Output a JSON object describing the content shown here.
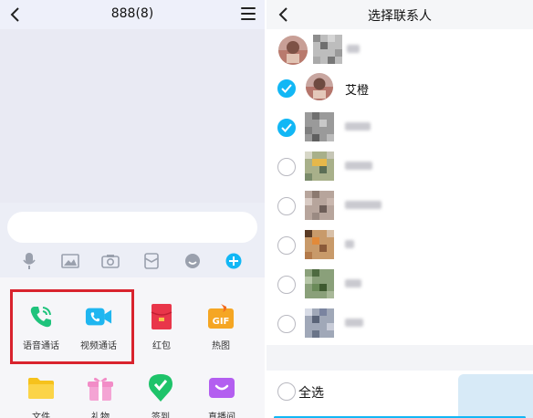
{
  "chat": {
    "title": "888(8)",
    "panel_apps": [
      {
        "label": "语音通话",
        "icon": "voice-call-icon",
        "color": "#1fc37c"
      },
      {
        "label": "视频通话",
        "icon": "video-call-icon",
        "color": "#1fb6f0"
      },
      {
        "label": "红包",
        "icon": "red-packet-icon",
        "color": "#e9364a"
      },
      {
        "label": "热图",
        "icon": "gif-icon",
        "color": "#f5a623"
      },
      {
        "label": "文件",
        "icon": "folder-icon",
        "color": "#f6c21c"
      },
      {
        "label": "礼物",
        "icon": "gift-icon",
        "color": "#f28cc7"
      },
      {
        "label": "签到",
        "icon": "checkin-icon",
        "color": "#1ec36a"
      },
      {
        "label": "直播间",
        "icon": "live-room-icon",
        "color": "#b35ef0"
      }
    ]
  },
  "select_contacts": {
    "title": "选择联系人",
    "contacts": [
      {
        "name": "",
        "checked": null
      },
      {
        "name": "艾橙",
        "checked": true
      },
      {
        "name": "",
        "checked": true
      },
      {
        "name": "",
        "checked": false
      },
      {
        "name": "",
        "checked": false
      },
      {
        "name": "",
        "checked": false
      },
      {
        "name": "",
        "checked": false
      },
      {
        "name": "",
        "checked": false
      }
    ],
    "select_all_label": "全选"
  },
  "colors": {
    "accent": "#12b7f5",
    "highlight": "#d9232e"
  }
}
